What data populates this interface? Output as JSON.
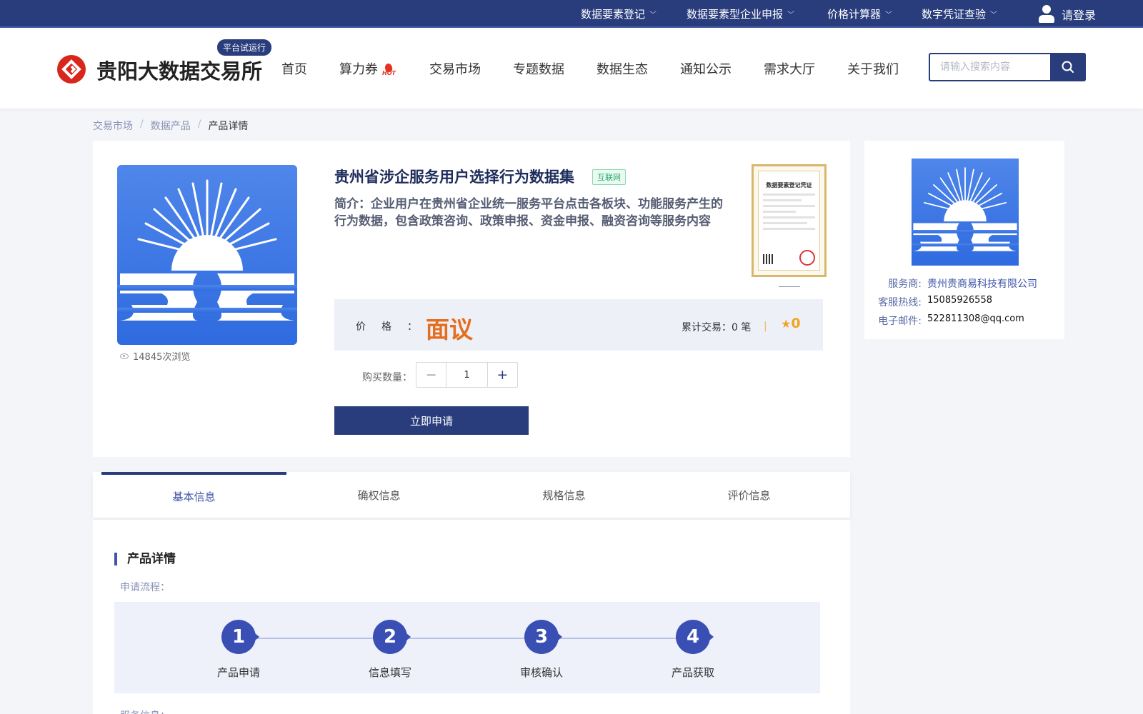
{
  "topbar": {
    "menus": [
      {
        "label": "数据要素登记"
      },
      {
        "label": "数据要素型企业申报"
      },
      {
        "label": "价格计算器"
      },
      {
        "label": "数字凭证查验"
      }
    ],
    "login_label": "请登录"
  },
  "header": {
    "brand": "贵阳大数据交易所",
    "trial_badge": "平台试运行",
    "nav": [
      {
        "label": "首页"
      },
      {
        "label": "算力券"
      },
      {
        "label": "交易市场"
      },
      {
        "label": "专题数据"
      },
      {
        "label": "数据生态"
      },
      {
        "label": "通知公示"
      },
      {
        "label": "需求大厅"
      },
      {
        "label": "关于我们"
      }
    ],
    "hot_label": "HOT",
    "search_placeholder": "请输入搜索内容",
    "accent_color": "#293c7c"
  },
  "breadcrumb": [
    {
      "label": "交易市场"
    },
    {
      "label": "数据产品"
    },
    {
      "label": "产品详情"
    }
  ],
  "breadcrumb_sep": "/",
  "product": {
    "title": "贵州省涉企服务用户选择行为数据集",
    "tag": "互联网",
    "intro": "简介：企业用户在贵州省企业统一服务平台点击各板块、功能服务产生的行为数据，包含政策咨询、政策申报、资金申报、融资咨询等服务内容",
    "views": "14845次浏览",
    "certificate_title": "数据要素登记凭证",
    "price_label": "价格：",
    "price_value": "面议",
    "trade_label": "累计交易：",
    "trade_value": "0",
    "trade_unit": "笔",
    "divider": "|",
    "rating": "0",
    "quantity_label": "购买数量：",
    "quantity_value": "1",
    "minus_label": "−",
    "plus_label": "+",
    "apply_label": "立即申请"
  },
  "provider": {
    "service_label": "服务商:",
    "service_value": "贵州贵商易科技有限公司",
    "hotline_label": "客服热线:",
    "hotline_value": "15085926558",
    "email_label": "电子邮件:",
    "email_value": "522811308@qq.com"
  },
  "tabs": [
    {
      "label": "基本信息",
      "active": true
    },
    {
      "label": "确权信息"
    },
    {
      "label": "规格信息"
    },
    {
      "label": "评价信息"
    }
  ],
  "detail": {
    "section_title": "产品详情",
    "process_label": "申请流程：",
    "steps": [
      {
        "num": "1",
        "label": "产品申请"
      },
      {
        "num": "2",
        "label": "信息填写"
      },
      {
        "num": "3",
        "label": "审核确认"
      },
      {
        "num": "4",
        "label": "产品获取"
      }
    ],
    "service_info_label": "服务信息："
  },
  "icons": {
    "logo": "exchange-logo-icon",
    "user": "user-icon",
    "search": "search-icon",
    "hot": "hot-flame-icon",
    "eye": "eye-icon",
    "star": "star-icon",
    "chevron": "chevron-down-icon"
  }
}
